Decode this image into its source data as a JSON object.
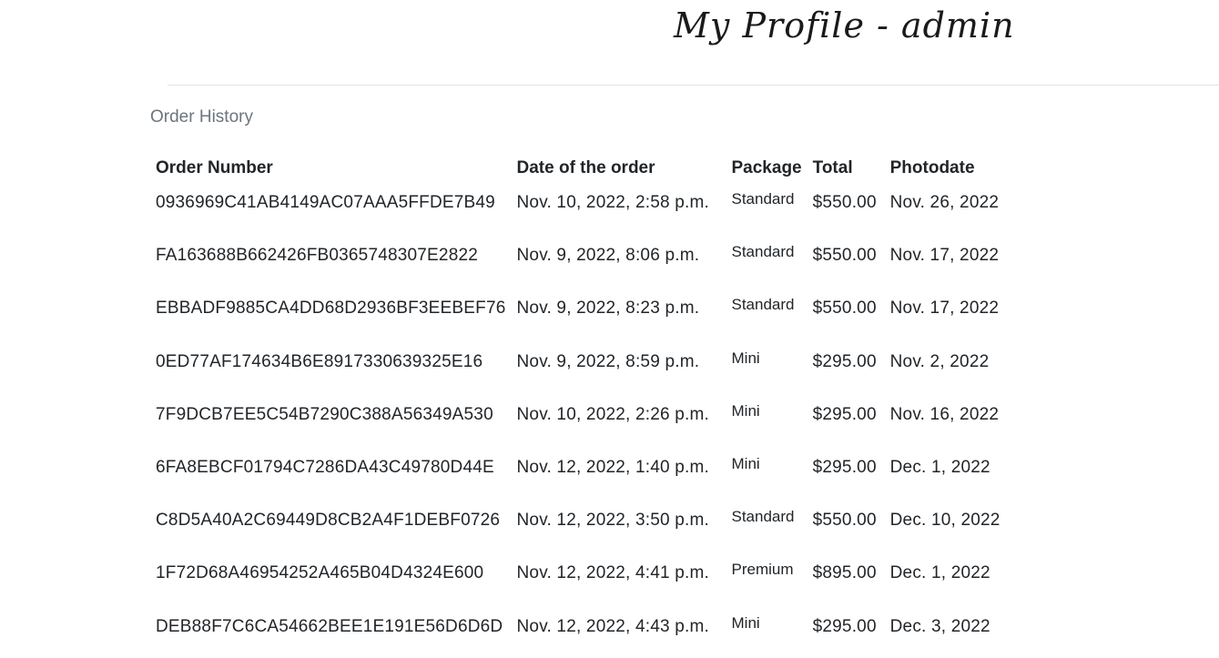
{
  "header": {
    "title": "My Profile - admin"
  },
  "section": {
    "title": "Order History"
  },
  "table": {
    "columns": [
      "Order Number",
      "Date of the order",
      "Package",
      "Total",
      "Photodate"
    ],
    "rows": [
      {
        "order_number": "0936969C41AB4149AC07AAA5FFDE7B49",
        "date": "Nov. 10, 2022, 2:58 p.m.",
        "package": "Standard",
        "total": "$550.00",
        "photodate": "Nov. 26, 2022"
      },
      {
        "order_number": "FA163688B662426FB0365748307E2822",
        "date": "Nov. 9, 2022, 8:06 p.m.",
        "package": "Standard",
        "total": "$550.00",
        "photodate": "Nov. 17, 2022"
      },
      {
        "order_number": "EBBADF9885CA4DD68D2936BF3EEBEF76",
        "date": "Nov. 9, 2022, 8:23 p.m.",
        "package": "Standard",
        "total": "$550.00",
        "photodate": "Nov. 17, 2022"
      },
      {
        "order_number": "0ED77AF174634B6E8917330639325E16",
        "date": "Nov. 9, 2022, 8:59 p.m.",
        "package": "Mini",
        "total": "$295.00",
        "photodate": "Nov. 2, 2022"
      },
      {
        "order_number": "7F9DCB7EE5C54B7290C388A56349A530",
        "date": "Nov. 10, 2022, 2:26 p.m.",
        "package": "Mini",
        "total": "$295.00",
        "photodate": "Nov. 16, 2022"
      },
      {
        "order_number": "6FA8EBCF01794C7286DA43C49780D44E",
        "date": "Nov. 12, 2022, 1:40 p.m.",
        "package": "Mini",
        "total": "$295.00",
        "photodate": "Dec. 1, 2022"
      },
      {
        "order_number": "C8D5A40A2C69449D8CB2A4F1DEBF0726",
        "date": "Nov. 12, 2022, 3:50 p.m.",
        "package": "Standard",
        "total": "$550.00",
        "photodate": "Dec. 10, 2022"
      },
      {
        "order_number": "1F72D68A46954252A465B04D4324E600",
        "date": "Nov. 12, 2022, 4:41 p.m.",
        "package": "Premium",
        "total": "$895.00",
        "photodate": "Dec. 1, 2022"
      },
      {
        "order_number": "DEB88F7C6CA54662BEE1E191E56D6D6D",
        "date": "Nov. 12, 2022, 4:43 p.m.",
        "package": "Mini",
        "total": "$295.00",
        "photodate": "Dec. 3, 2022"
      }
    ]
  }
}
